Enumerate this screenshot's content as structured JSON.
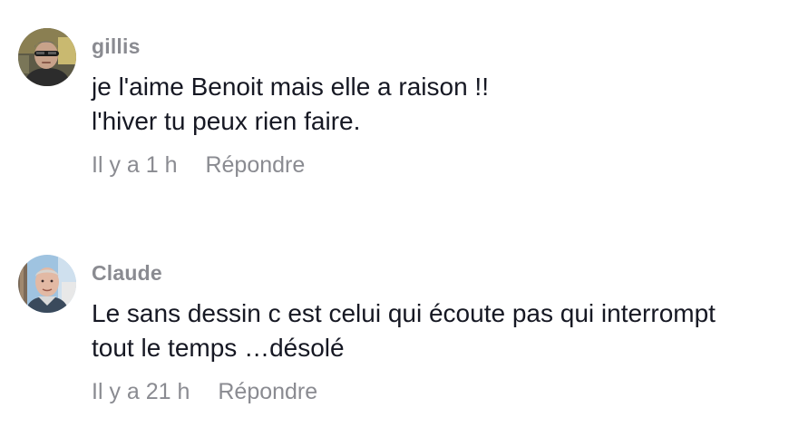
{
  "comments": [
    {
      "username": "gillis",
      "avatar_icon": "user-avatar-sunglasses",
      "text_lines": [
        "je l'aime Benoit mais elle a raison !!",
        "l'hiver tu peux rien faire."
      ],
      "time": "Il y a 1 h",
      "reply_label": "Répondre"
    },
    {
      "username": "Claude",
      "avatar_icon": "user-avatar-man-outdoors",
      "text_lines": [
        "Le sans dessin c est celui qui écoute pas qui interrompt",
        "tout le temps …désolé"
      ],
      "time": "Il y a 21 h",
      "reply_label": "Répondre"
    }
  ]
}
